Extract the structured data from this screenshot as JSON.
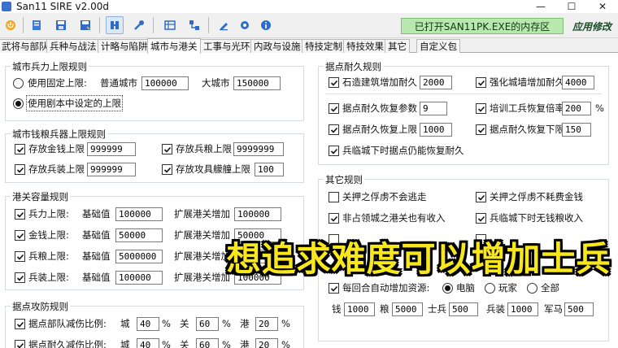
{
  "window": {
    "title": "San11 SIRE v2.00d",
    "minimize": "—",
    "maximize": "☐",
    "close": "✕"
  },
  "toolbar": {
    "status_banner": "已打开SAN11PK.EXE的内存区",
    "apply_label": "应用修改",
    "icons": [
      "power-icon",
      "open-file-icon",
      "save-icon",
      "save-as-icon",
      "simplified-icon",
      "tools-icon",
      "table-icon",
      "network-icon",
      "edit-icon",
      "settings-icon",
      "info-icon"
    ]
  },
  "tabs": [
    "武将与部队",
    "兵种与战法",
    "计略与陷阱",
    "城市与港关",
    "工事与光环",
    "内政与设施",
    "特技定制",
    "特技效果",
    "其它",
    "自定义包"
  ],
  "city_cap": {
    "title": "城市兵力上限规则",
    "opt_fixed": "使用固定上限:",
    "normal_city_label": "普通城市",
    "normal_city_value": "100000",
    "big_city_label": "大城市",
    "big_city_value": "150000",
    "opt_script": "使用剧本中设定的上限"
  },
  "supply_cap": {
    "title": "城市钱粮兵器上限规则",
    "gold_label": "存放金钱上限",
    "gold_value": "999999",
    "food_label": "存放兵粮上限",
    "food_value": "9999999",
    "arms_label": "存放兵装上限",
    "arms_value": "999999",
    "siege_label": "存放攻具艨艟上限",
    "siege_value": "100"
  },
  "port_cap": {
    "title": "港关容量规则",
    "base_label": "基础值",
    "expand_label": "扩展港关增加",
    "rows": [
      {
        "label": "兵力上限:",
        "base": "100000",
        "expand": "100000"
      },
      {
        "label": "金钱上限:",
        "base": "50000",
        "expand": "50000"
      },
      {
        "label": "兵粮上限:",
        "base": "5000000",
        "expand": "5000000"
      },
      {
        "label": "兵装上限:",
        "base": "100000",
        "expand": "100000"
      }
    ]
  },
  "defense": {
    "title": "据点攻防规则",
    "city_label": "城",
    "pass_label": "关",
    "port_label": "港",
    "pct": "%",
    "rows": [
      {
        "label": "据点部队减伤比例:",
        "city": "40",
        "pass": "60",
        "port": "20"
      },
      {
        "label": "据点耐久减伤比例:",
        "city": "40",
        "pass": "60",
        "port": "20"
      }
    ]
  },
  "durability": {
    "title": "据点耐久规则",
    "stone_label": "石造建筑增加耐久",
    "stone_value": "2000",
    "strong_label": "强化城墙增加耐久",
    "strong_value": "4000",
    "recover_param_label": "据点耐久恢复参数",
    "recover_param_value": "9",
    "train_label": "培训工兵恢复倍率",
    "train_value": "200",
    "pct": "%",
    "recover_max_label": "据点耐久恢复上限",
    "recover_max_value": "1000",
    "recover_min_label": "据点耐久恢复下限",
    "recover_min_value": "150",
    "besieged_label": "兵临城下时据点仍能恢复耐久"
  },
  "misc": {
    "title": "其它规则",
    "r1": "关押之俘虏不会逃走",
    "r2": "关押之俘虏不耗费金钱",
    "r3": "非占领城之港关也有收入",
    "r4": "兵临城下时无钱粮收入",
    "r5": "",
    "r6": "",
    "auto_label": "每回合自动增加资源:",
    "opt_pc": "电脑",
    "opt_player": "玩家",
    "opt_all": "全部",
    "res": [
      {
        "label": "钱",
        "value": "1000"
      },
      {
        "label": "粮",
        "value": "5000"
      },
      {
        "label": "士兵",
        "value": "500"
      },
      {
        "label": "兵装",
        "value": "1000"
      },
      {
        "label": "军马",
        "value": "500"
      }
    ]
  },
  "overlay": {
    "caption": "想追求难度可以增加士兵"
  },
  "colors": {
    "banner_bg": "#b8e7b0",
    "overlay_text": "#f8e71c",
    "active_tab": "#ffffff"
  }
}
